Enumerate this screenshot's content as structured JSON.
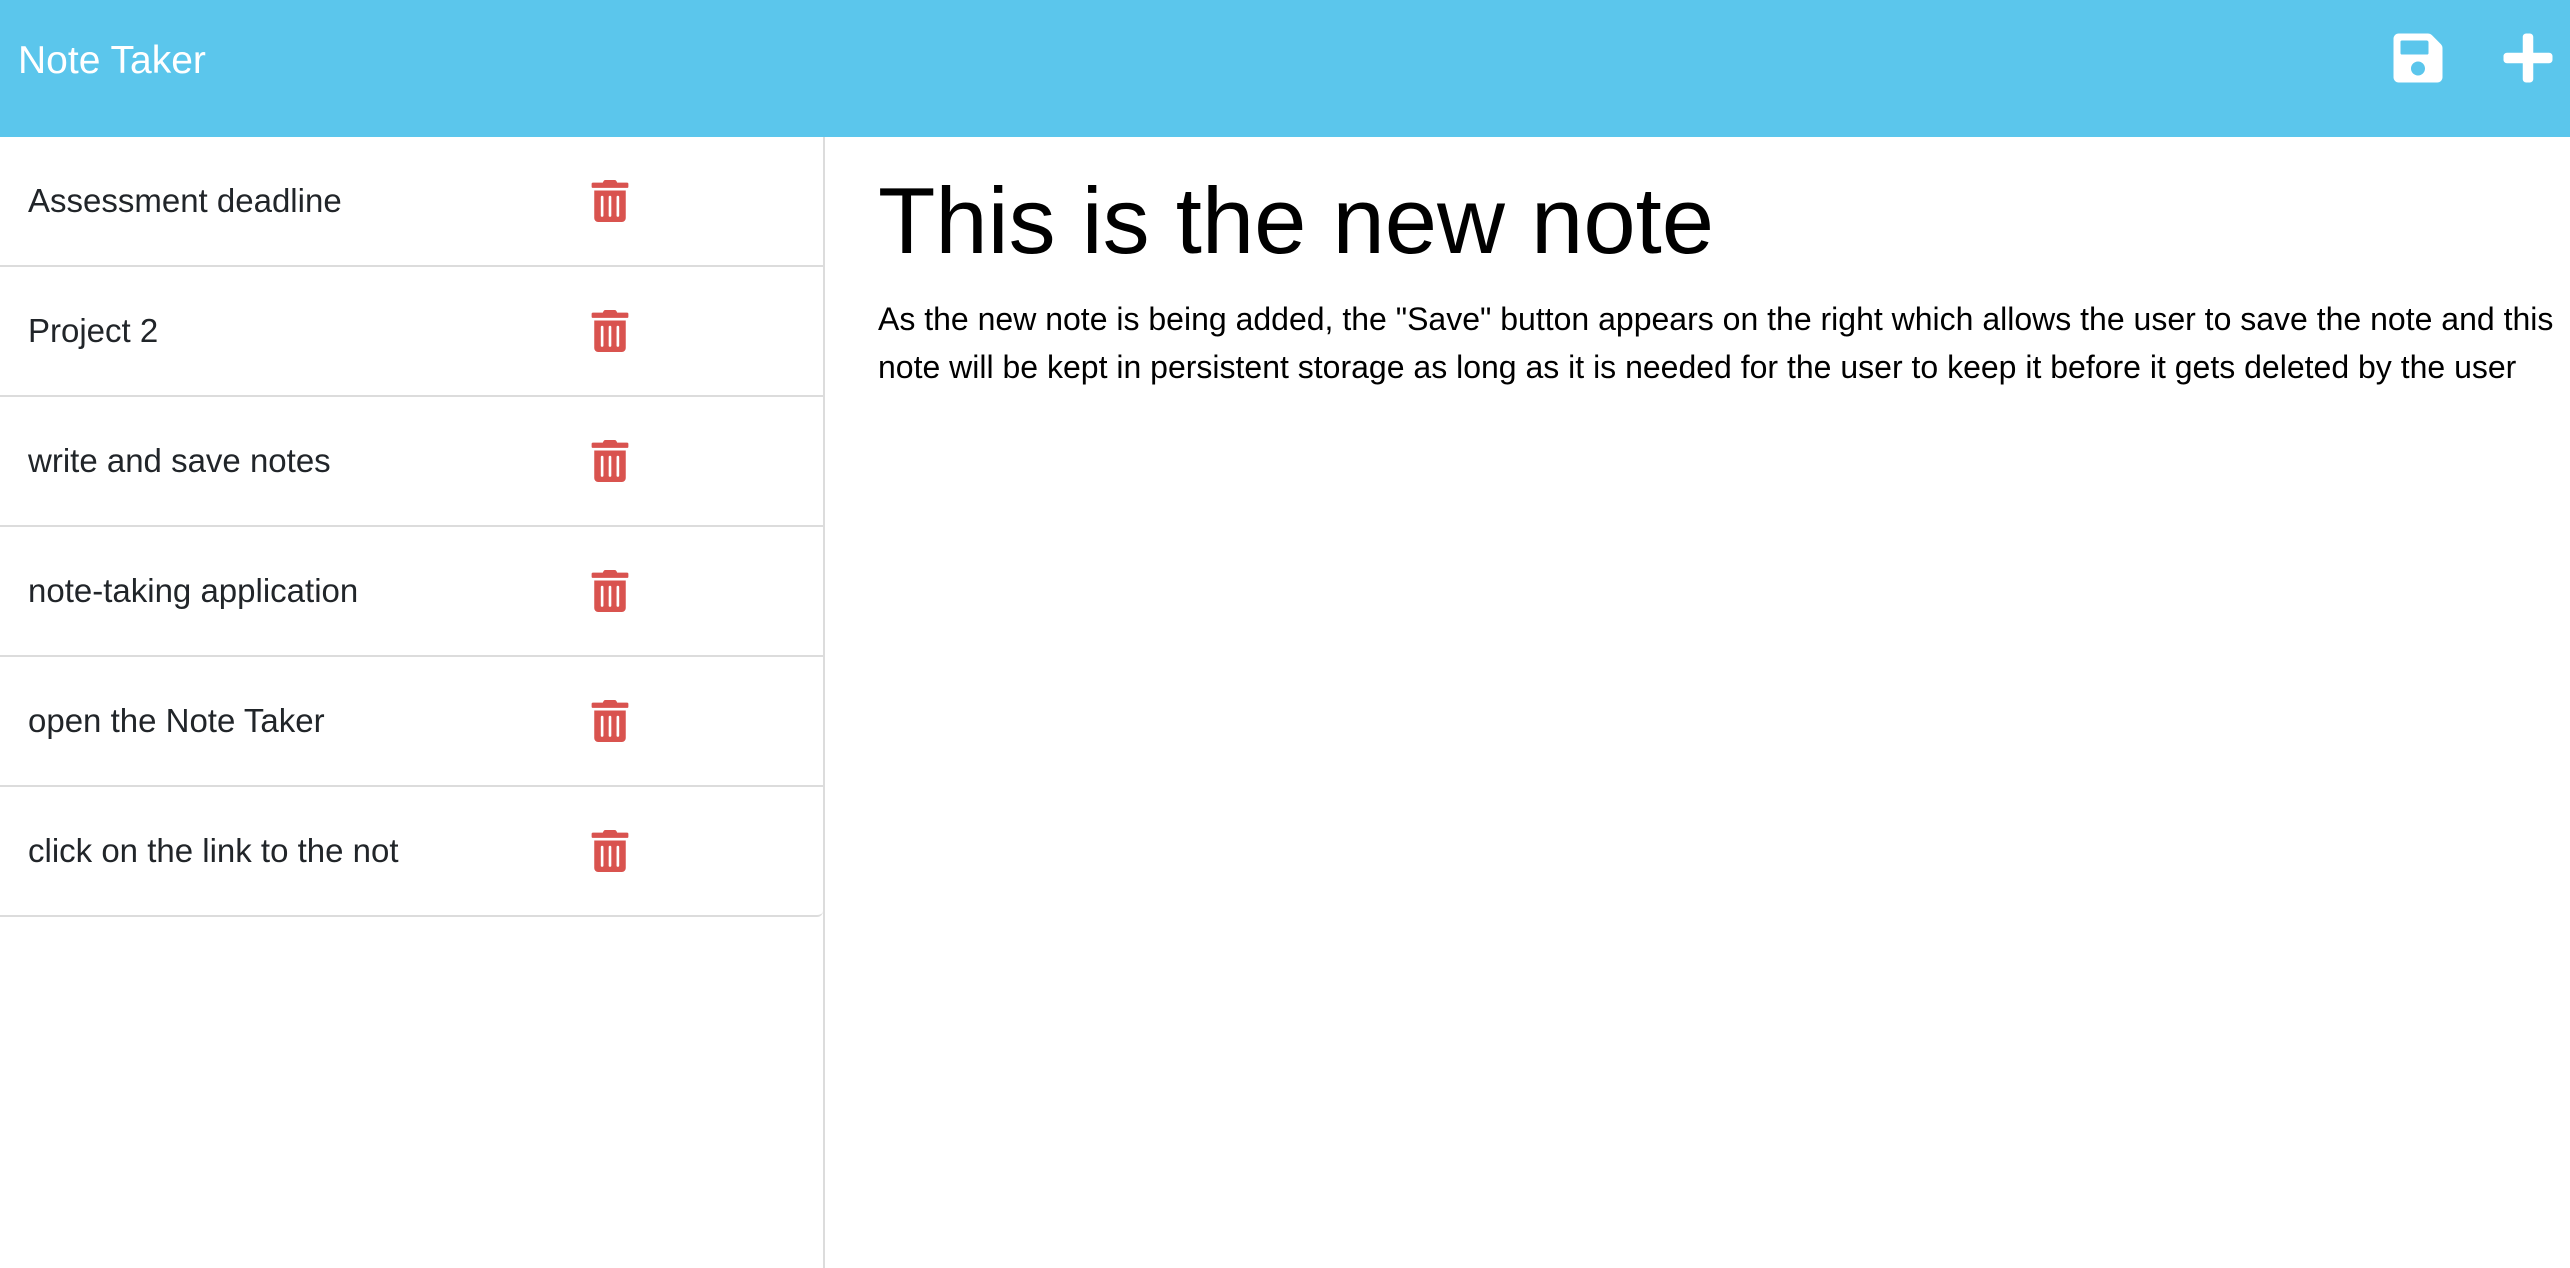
{
  "app": {
    "brand": "Note Taker"
  },
  "colors": {
    "navbar": "#5bc6ec",
    "delete_icon": "#d9534f",
    "nav_icon": "#ffffff"
  },
  "icons": {
    "save": "floppy-disk-icon",
    "new": "plus-icon",
    "delete": "trash-icon"
  },
  "notes": [
    {
      "title": "Assessment deadline"
    },
    {
      "title": "Project 2"
    },
    {
      "title": "write and save notes"
    },
    {
      "title": "note-taking application"
    },
    {
      "title": "open the Note Taker"
    },
    {
      "title": "click on the link to the not"
    }
  ],
  "active_note": {
    "title": "This is the new note",
    "text": "As the new note is being added, the \"Save\" button appears on the right which allows the user to save the note and this note will be kept in persistent storage as long as it is needed for the user to keep it before it gets deleted by the user"
  }
}
